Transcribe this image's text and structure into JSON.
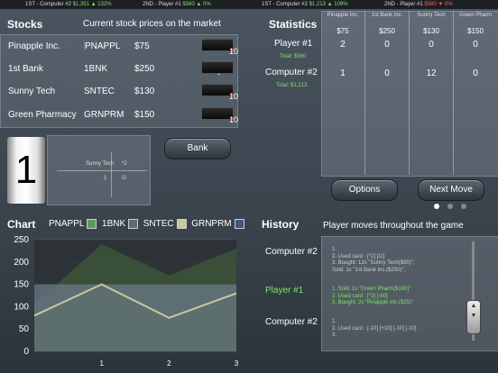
{
  "ticker": {
    "items": [
      {
        "label": "1ST - Computer #2",
        "value": "$1,351",
        "change": "132%",
        "dir": "up"
      },
      {
        "label": "2ND - Player #1",
        "value": "$580",
        "change": "0%",
        "dir": "up"
      },
      {
        "label": "1ST - Computer #2",
        "value": "$1,213",
        "change": "109%",
        "dir": "up"
      },
      {
        "label": "2ND - Player #1",
        "value": "$580",
        "change": "0%",
        "dir": "down"
      }
    ]
  },
  "stocks": {
    "title": "Stocks",
    "subtitle": "Current stock prices on the market",
    "rows": [
      {
        "name": "Pinapple Inc.",
        "symbol": "PNAPPL",
        "price": "$75",
        "sell": "10"
      },
      {
        "name": "1st Bank",
        "symbol": "1BNK",
        "price": "$250",
        "sell": "-"
      },
      {
        "name": "Sunny Tech",
        "symbol": "SNTEC",
        "price": "$130",
        "sell": "10"
      },
      {
        "name": "Green Pharmacy",
        "symbol": "GRNPRM",
        "price": "$150",
        "sell": "10"
      }
    ]
  },
  "statistics": {
    "title": "Statistics",
    "columns": [
      {
        "name": "Pinapple Inc.",
        "price": "$75"
      },
      {
        "name": "1st Bank Inc.",
        "price": "$250"
      },
      {
        "name": "Sunny Tech",
        "price": "$130"
      },
      {
        "name": "Green Pharm",
        "price": "$150"
      }
    ],
    "players": [
      {
        "name": "Player #1",
        "total": "Total: $580",
        "holdings": [
          "2",
          "0",
          "0",
          "0"
        ]
      },
      {
        "name": "Computer #2",
        "total": "Total: $1,213",
        "holdings": [
          "1",
          "0",
          "12",
          "0"
        ]
      }
    ]
  },
  "dice": {
    "value": "1"
  },
  "card": {
    "stock": "Sunny Tech",
    "rows": [
      [
        "",
        "*2"
      ],
      [
        "1",
        "/2"
      ]
    ]
  },
  "buttons": {
    "bank": "Bank",
    "options": "Options",
    "next_move": "Next Move"
  },
  "chart_section": {
    "title": "Chart",
    "legend": [
      {
        "name": "PNAPPL",
        "color": "#5a9a5a"
      },
      {
        "name": "1BNK",
        "color": "#666a6e"
      },
      {
        "name": "SNTEC",
        "color": "#c8c8a0"
      },
      {
        "name": "GRNPRM",
        "color": "#3a5a80"
      }
    ]
  },
  "chart_data": {
    "type": "area",
    "x": [
      0,
      1,
      2,
      3
    ],
    "ylim": [
      0,
      250
    ],
    "yticks": [
      "0",
      "50",
      "100",
      "150",
      "200",
      "250"
    ],
    "xticks": [
      "1",
      "2",
      "3"
    ],
    "series": [
      {
        "name": "1BNK",
        "color": "#2a2e33",
        "values": [
          250,
          250,
          250,
          250
        ]
      },
      {
        "name": "PNAPPL",
        "color": "#3d5a3a",
        "values": [
          105,
          240,
          170,
          230
        ]
      },
      {
        "name": "GRNPRM",
        "color": "#6a7a8a",
        "values": [
          150,
          150,
          150,
          150
        ]
      },
      {
        "name": "SNTEC",
        "color": "#c8c8a0",
        "values": [
          80,
          150,
          75,
          130
        ]
      }
    ]
  },
  "history": {
    "title": "History",
    "subtitle": "Player moves throughout the game",
    "entries": [
      {
        "player": "Computer #2",
        "color": "#ffffff",
        "text": "1.\n2. Used card : [*2] [/2]\n3. Bought: 12x \"Sunny Tech($80)\";\nSold: 1x \"1st Bank Inc.($250)\";"
      },
      {
        "player": "Player #1",
        "color": "#7fe36a",
        "text": "1. Sold: 1x \"Green Pharm($160)\"\n2. Used card : [*3] [-60]\n3. Bought: 2x \"Pinapple Inc.($25)\""
      },
      {
        "player": "Computer #2",
        "color": "#ffffff",
        "text": "1.\n2. Used card : [-10] [+10] [-10] [-10]\n3."
      }
    ]
  }
}
